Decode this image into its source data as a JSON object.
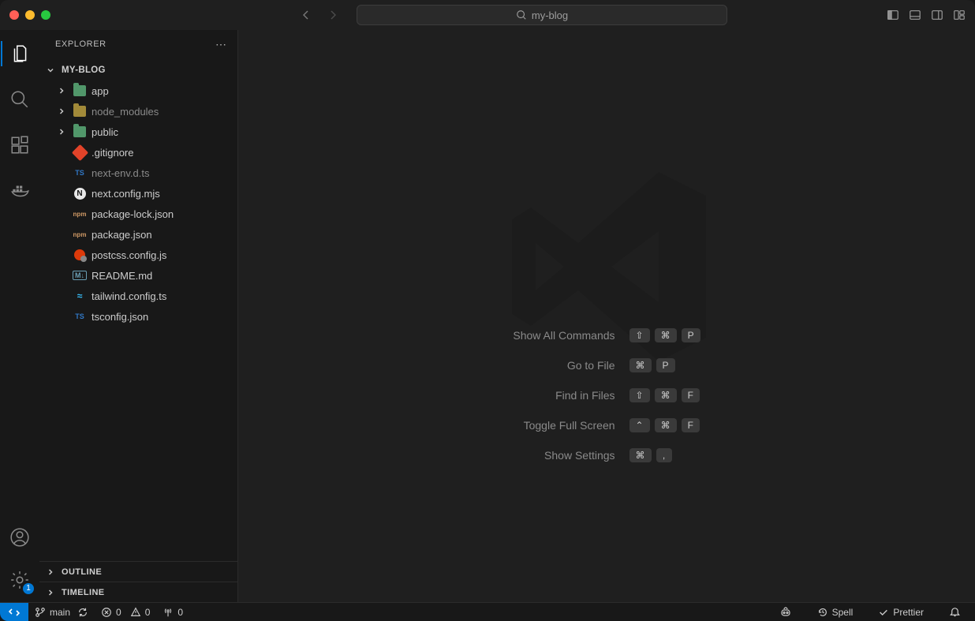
{
  "titlebar": {
    "search_text": "my-blog"
  },
  "sidebar": {
    "header": "EXPLORER",
    "root": "MY-BLOG",
    "tree": [
      {
        "name": "app",
        "type": "folder",
        "icon": "folder-green",
        "dim": false
      },
      {
        "name": "node_modules",
        "type": "folder",
        "icon": "folder-yellow",
        "dim": true
      },
      {
        "name": "public",
        "type": "folder",
        "icon": "folder-green",
        "dim": false
      },
      {
        "name": ".gitignore",
        "type": "file",
        "icon": "git",
        "dim": false
      },
      {
        "name": "next-env.d.ts",
        "type": "file",
        "icon": "ts",
        "dim": true
      },
      {
        "name": "next.config.mjs",
        "type": "file",
        "icon": "next",
        "dim": false
      },
      {
        "name": "package-lock.json",
        "type": "file",
        "icon": "json",
        "dim": false
      },
      {
        "name": "package.json",
        "type": "file",
        "icon": "json",
        "dim": false
      },
      {
        "name": "postcss.config.js",
        "type": "file",
        "icon": "postcss",
        "dim": false
      },
      {
        "name": "README.md",
        "type": "file",
        "icon": "md",
        "dim": false
      },
      {
        "name": "tailwind.config.ts",
        "type": "file",
        "icon": "tailwind",
        "dim": false
      },
      {
        "name": "tsconfig.json",
        "type": "file",
        "icon": "tsjson",
        "dim": false
      }
    ],
    "outline": "OUTLINE",
    "timeline": "TIMELINE"
  },
  "shortcuts": [
    {
      "label": "Show All Commands",
      "keys": [
        "⇧",
        "⌘",
        "P"
      ]
    },
    {
      "label": "Go to File",
      "keys": [
        "⌘",
        "P"
      ]
    },
    {
      "label": "Find in Files",
      "keys": [
        "⇧",
        "⌘",
        "F"
      ]
    },
    {
      "label": "Toggle Full Screen",
      "keys": [
        "⌃",
        "⌘",
        "F"
      ]
    },
    {
      "label": "Show Settings",
      "keys": [
        "⌘",
        ","
      ]
    }
  ],
  "statusbar": {
    "branch": "main",
    "errors": "0",
    "warnings": "0",
    "ports": "0",
    "spell": "Spell",
    "prettier": "Prettier"
  },
  "activity_badge": "1"
}
